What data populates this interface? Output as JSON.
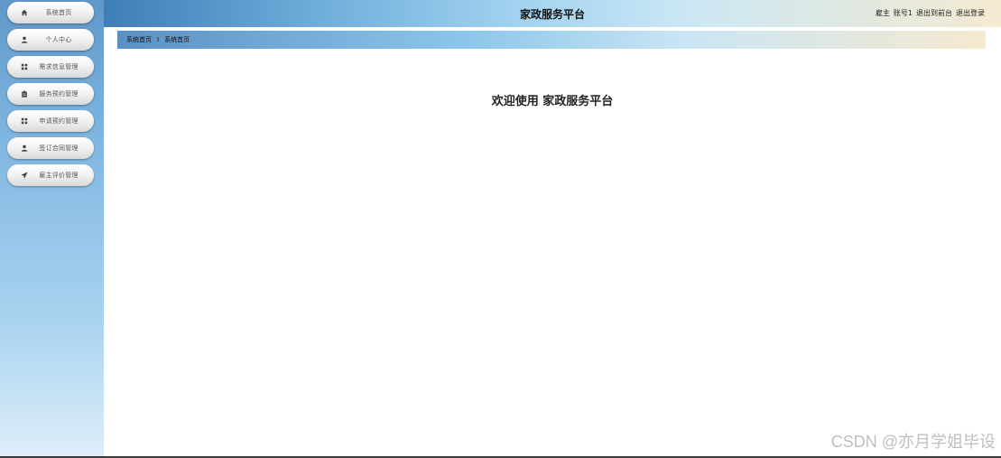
{
  "header": {
    "title": "家政服务平台",
    "user_role": "雇主",
    "user_name": "账号1",
    "back_to_front": "退出到前台",
    "logout": "退出登录"
  },
  "breadcrumb": {
    "items": [
      "系统首页",
      "系统首页"
    ],
    "separator": "Ⅰ"
  },
  "sidebar": {
    "items": [
      {
        "label": "系统首页",
        "icon": "home-icon"
      },
      {
        "label": "个人中心",
        "icon": "user-icon"
      },
      {
        "label": "需求信息管理",
        "icon": "grid-icon"
      },
      {
        "label": "服务预约管理",
        "icon": "clipboard-icon"
      },
      {
        "label": "申请预约管理",
        "icon": "grid-icon"
      },
      {
        "label": "签订合同管理",
        "icon": "user-icon"
      },
      {
        "label": "雇主评价管理",
        "icon": "send-icon"
      }
    ]
  },
  "main": {
    "welcome": "欢迎使用 家政服务平台"
  },
  "watermark": "CSDN @亦月学姐毕设",
  "colors": {
    "sidebar_top": "#5f97c9",
    "header_left": "#3f7db6",
    "header_right": "#f4ead0"
  }
}
